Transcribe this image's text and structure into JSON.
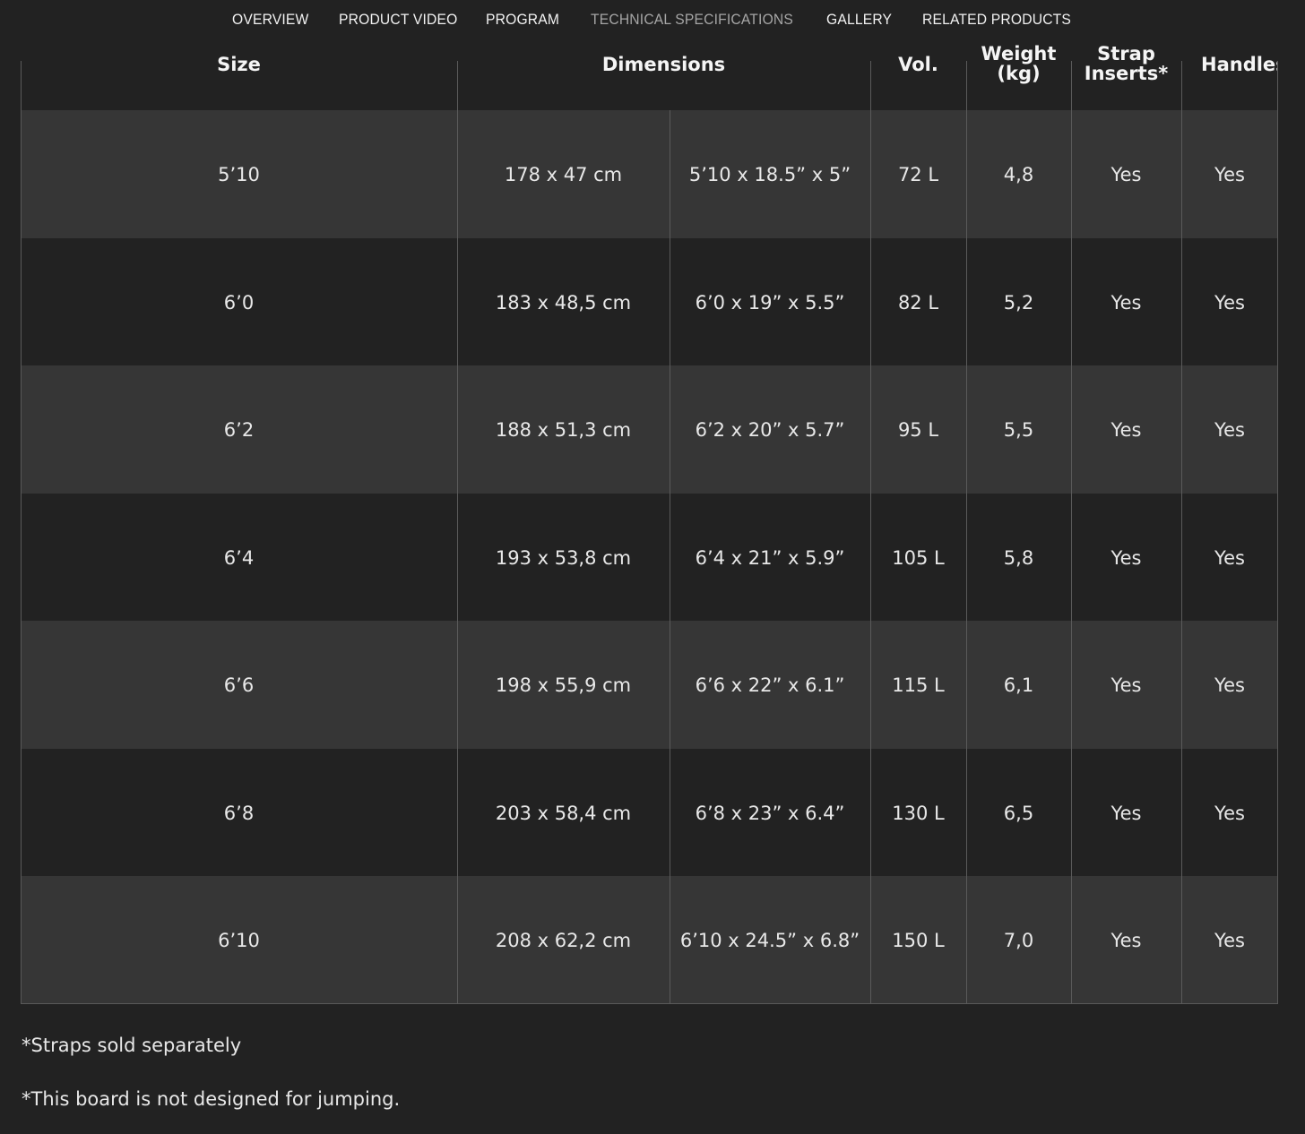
{
  "nav": {
    "items": [
      {
        "label": "OVERVIEW",
        "active": false
      },
      {
        "label": "PRODUCT VIDEO",
        "active": false
      },
      {
        "label": "PROGRAM",
        "active": false
      },
      {
        "label": "TECHNICAL SPECIFICATIONS",
        "active": true
      },
      {
        "label": "GALLERY",
        "active": false
      },
      {
        "label": "RELATED PRODUCTS",
        "active": false
      }
    ]
  },
  "table": {
    "headers": {
      "size": "Size",
      "dimensions": "Dimensions",
      "volume": "Vol.",
      "weight_line1": "Weight",
      "weight_line2": "(kg)",
      "strap_line1": "Strap",
      "strap_line2": "Inserts*",
      "handles": "Handles"
    },
    "rows": [
      {
        "size": "5’10",
        "metric": "178 x 47 cm",
        "imperial": "5’10 x 18.5” x 5”",
        "volume": "72 L",
        "weight": "4,8",
        "strap_inserts": "Yes",
        "handles": "Yes"
      },
      {
        "size": "6’0",
        "metric": "183 x 48,5 cm",
        "imperial": "6’0 x 19” x 5.5”",
        "volume": "82 L",
        "weight": "5,2",
        "strap_inserts": "Yes",
        "handles": "Yes"
      },
      {
        "size": "6’2",
        "metric": "188 x 51,3 cm",
        "imperial": "6’2 x 20” x 5.7”",
        "volume": "95 L",
        "weight": "5,5",
        "strap_inserts": "Yes",
        "handles": "Yes"
      },
      {
        "size": "6’4",
        "metric": "193 x 53,8 cm",
        "imperial": "6’4 x 21” x 5.9”",
        "volume": "105 L",
        "weight": "5,8",
        "strap_inserts": "Yes",
        "handles": "Yes"
      },
      {
        "size": "6’6",
        "metric": "198 x 55,9 cm",
        "imperial": "6’6 x 22” x 6.1”",
        "volume": "115 L",
        "weight": "6,1",
        "strap_inserts": "Yes",
        "handles": "Yes"
      },
      {
        "size": "6’8",
        "metric": "203 x 58,4 cm",
        "imperial": "6’8 x 23” x 6.4”",
        "volume": "130 L",
        "weight": "6,5",
        "strap_inserts": "Yes",
        "handles": "Yes"
      },
      {
        "size": "6’10",
        "metric": "208 x 62,2 cm",
        "imperial": "6’10 x 24.5” x 6.8”",
        "volume": "150 L",
        "weight": "7,0",
        "strap_inserts": "Yes",
        "handles": "Yes"
      }
    ]
  },
  "notes": {
    "straps": "*Straps sold separately",
    "jumping": "*This board is not designed for jumping."
  },
  "colors": {
    "background": "#222222",
    "row_light": "#363636",
    "row_dark": "#222222",
    "nav_active": "#a6a6a6",
    "text": "#e8e8e8"
  }
}
